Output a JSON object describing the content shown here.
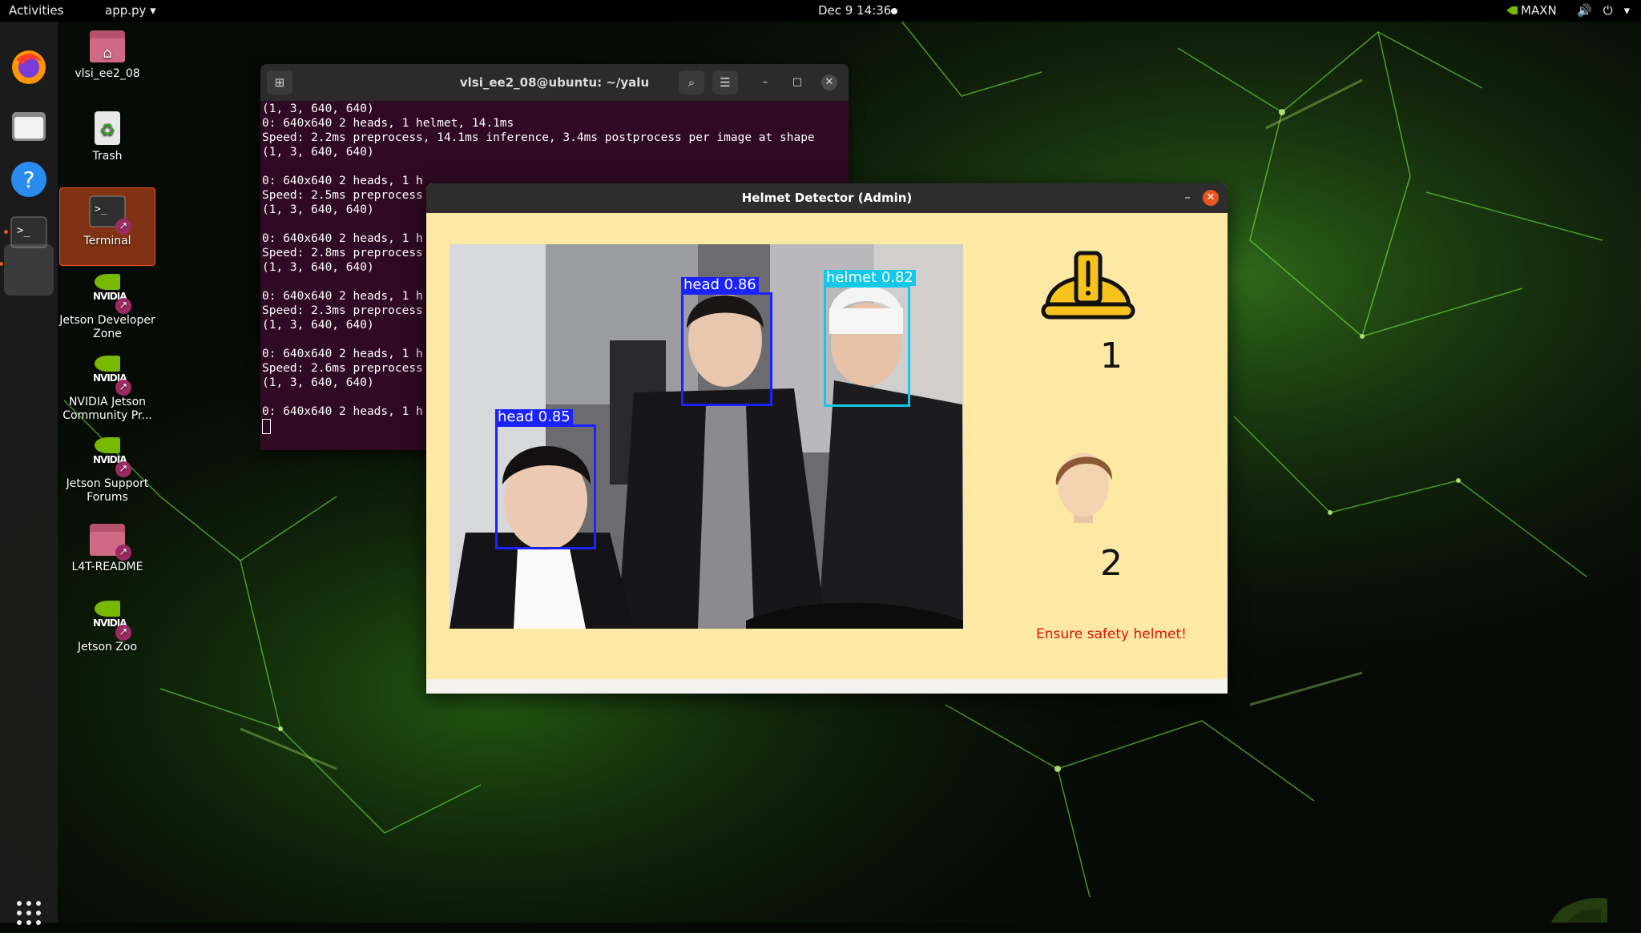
{
  "topbar": {
    "activities": "Activities",
    "app_menu": "app.py ▾",
    "clock": "Dec 9  14:36",
    "power_mode": "MAXN"
  },
  "desktop": {
    "icons": [
      {
        "label": "vlsi_ee2_08"
      },
      {
        "label": "Trash"
      },
      {
        "label": "Terminal"
      },
      {
        "label": "Jetson Developer Zone"
      },
      {
        "label": "NVIDIA Jetson Community Pr..."
      },
      {
        "label": "Jetson Support Forums"
      },
      {
        "label": "L4T-README"
      },
      {
        "label": "Jetson Zoo"
      }
    ]
  },
  "terminal": {
    "title": "vlsi_ee2_08@ubuntu: ~/yalu",
    "lines": [
      "(1, 3, 640, 640)",
      "",
      "0: 640x640 2 heads, 1 helmet, 14.1ms",
      "Speed: 2.2ms preprocess, 14.1ms inference, 3.4ms postprocess per image at shape",
      "(1, 3, 640, 640)",
      "",
      "0: 640x640 2 heads, 1 h",
      "Speed: 2.5ms preprocess",
      "(1, 3, 640, 640)",
      "",
      "0: 640x640 2 heads, 1 h",
      "Speed: 2.8ms preprocess",
      "(1, 3, 640, 640)",
      "",
      "0: 640x640 2 heads, 1 h",
      "Speed: 2.3ms preprocess",
      "(1, 3, 640, 640)",
      "",
      "0: 640x640 2 heads, 1 h",
      "Speed: 2.6ms preprocess",
      "(1, 3, 640, 640)",
      "",
      "0: 640x640 2 heads, 1 h"
    ]
  },
  "detector": {
    "title": "Helmet Detector (Admin)",
    "detections": [
      {
        "label": "head 0.85"
      },
      {
        "label": "head 0.86"
      },
      {
        "label": "helmet 0.82"
      }
    ],
    "helmet_count": "1",
    "head_count": "2",
    "warning": "Ensure safety helmet!"
  },
  "colors": {
    "accent": "#e95420",
    "window_bg": "#fde9a4",
    "head_box": "#1a22ff",
    "helmet_box": "#12c8e8",
    "warning": "#e0100e",
    "terminal_bg": "#300a24"
  }
}
